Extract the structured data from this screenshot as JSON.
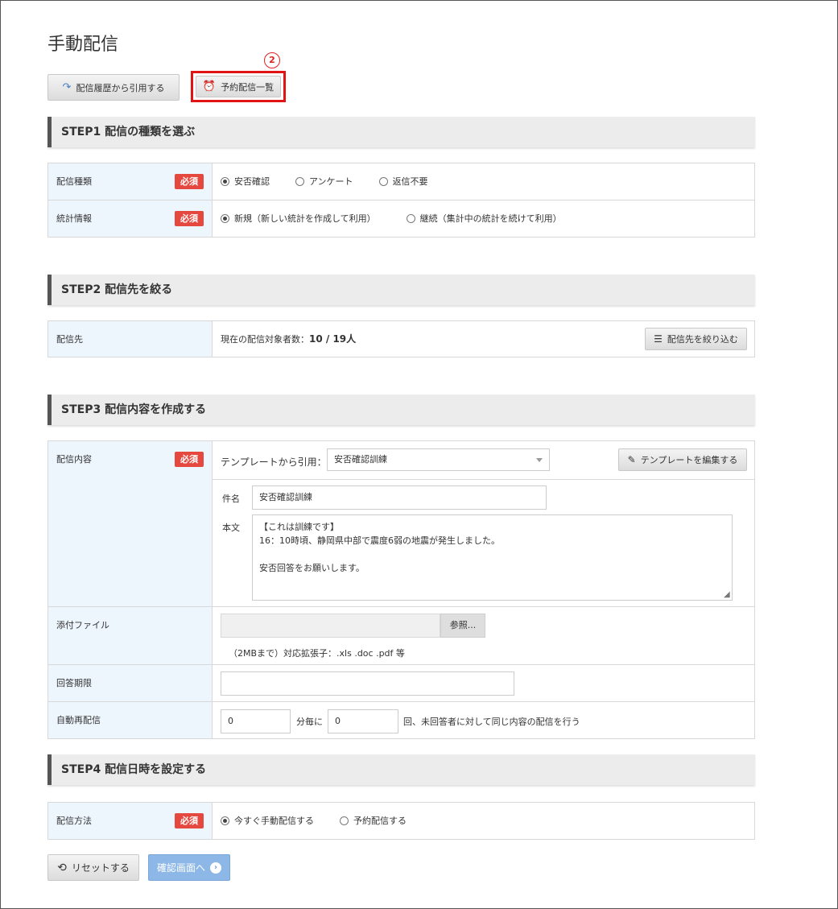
{
  "page": {
    "title": "手動配信"
  },
  "marker": {
    "label": "2"
  },
  "toolbar": {
    "history_label": "配信履歴から引用する",
    "schedule_label": "予約配信一覧"
  },
  "step1": {
    "header": "STEP1 配信の種類を選ぶ",
    "type": {
      "label": "配信種類",
      "required": "必須",
      "options": [
        "安否確認",
        "アンケート",
        "返信不要"
      ],
      "selected": "安否確認"
    },
    "stats": {
      "label": "統計情報",
      "required": "必須",
      "options": [
        "新規（新しい統計を作成して利用）",
        "継続（集計中の統計を続けて利用）"
      ],
      "selected": "新規（新しい統計を作成して利用）"
    }
  },
  "step2": {
    "header": "STEP2 配信先を絞る",
    "target": {
      "label": "配信先",
      "count_prefix": "現在の配信対象者数：",
      "count_value": "10 / 19人",
      "filter_button": "配信先を絞り込む"
    }
  },
  "step3": {
    "header": "STEP3 配信内容を作成する",
    "content": {
      "label": "配信内容",
      "required": "必須",
      "template_label": "テンプレートから引用：",
      "template_value": "安否確認訓練",
      "edit_template_button": "テンプレートを編集する",
      "subject_label": "件名",
      "subject_value": "安否確認訓練",
      "body_label": "本文",
      "body_value": "【これは訓練です】\n16：10時頃、静岡県中部で震度6弱の地震が発生しました。\n\n安否回答をお願いします。"
    },
    "attachment": {
      "label": "添付ファイル",
      "browse_button": "参照...",
      "note": "（2MBまで）対応拡張子：.xls .doc .pdf 等"
    },
    "deadline": {
      "label": "回答期限",
      "value": ""
    },
    "auto_resend": {
      "label": "自動再配信",
      "interval_value": "0",
      "interval_suffix": "分毎に",
      "count_value": "0",
      "count_suffix": "回、未回答者に対して同じ内容の配信を行う"
    }
  },
  "step4": {
    "header": "STEP4 配信日時を設定する",
    "method": {
      "label": "配信方法",
      "required": "必須",
      "options": [
        "今すぐ手動配信する",
        "予約配信する"
      ],
      "selected": "今すぐ手動配信する"
    }
  },
  "footer": {
    "reset_label": "リセットする",
    "confirm_label": "確認画面へ"
  }
}
